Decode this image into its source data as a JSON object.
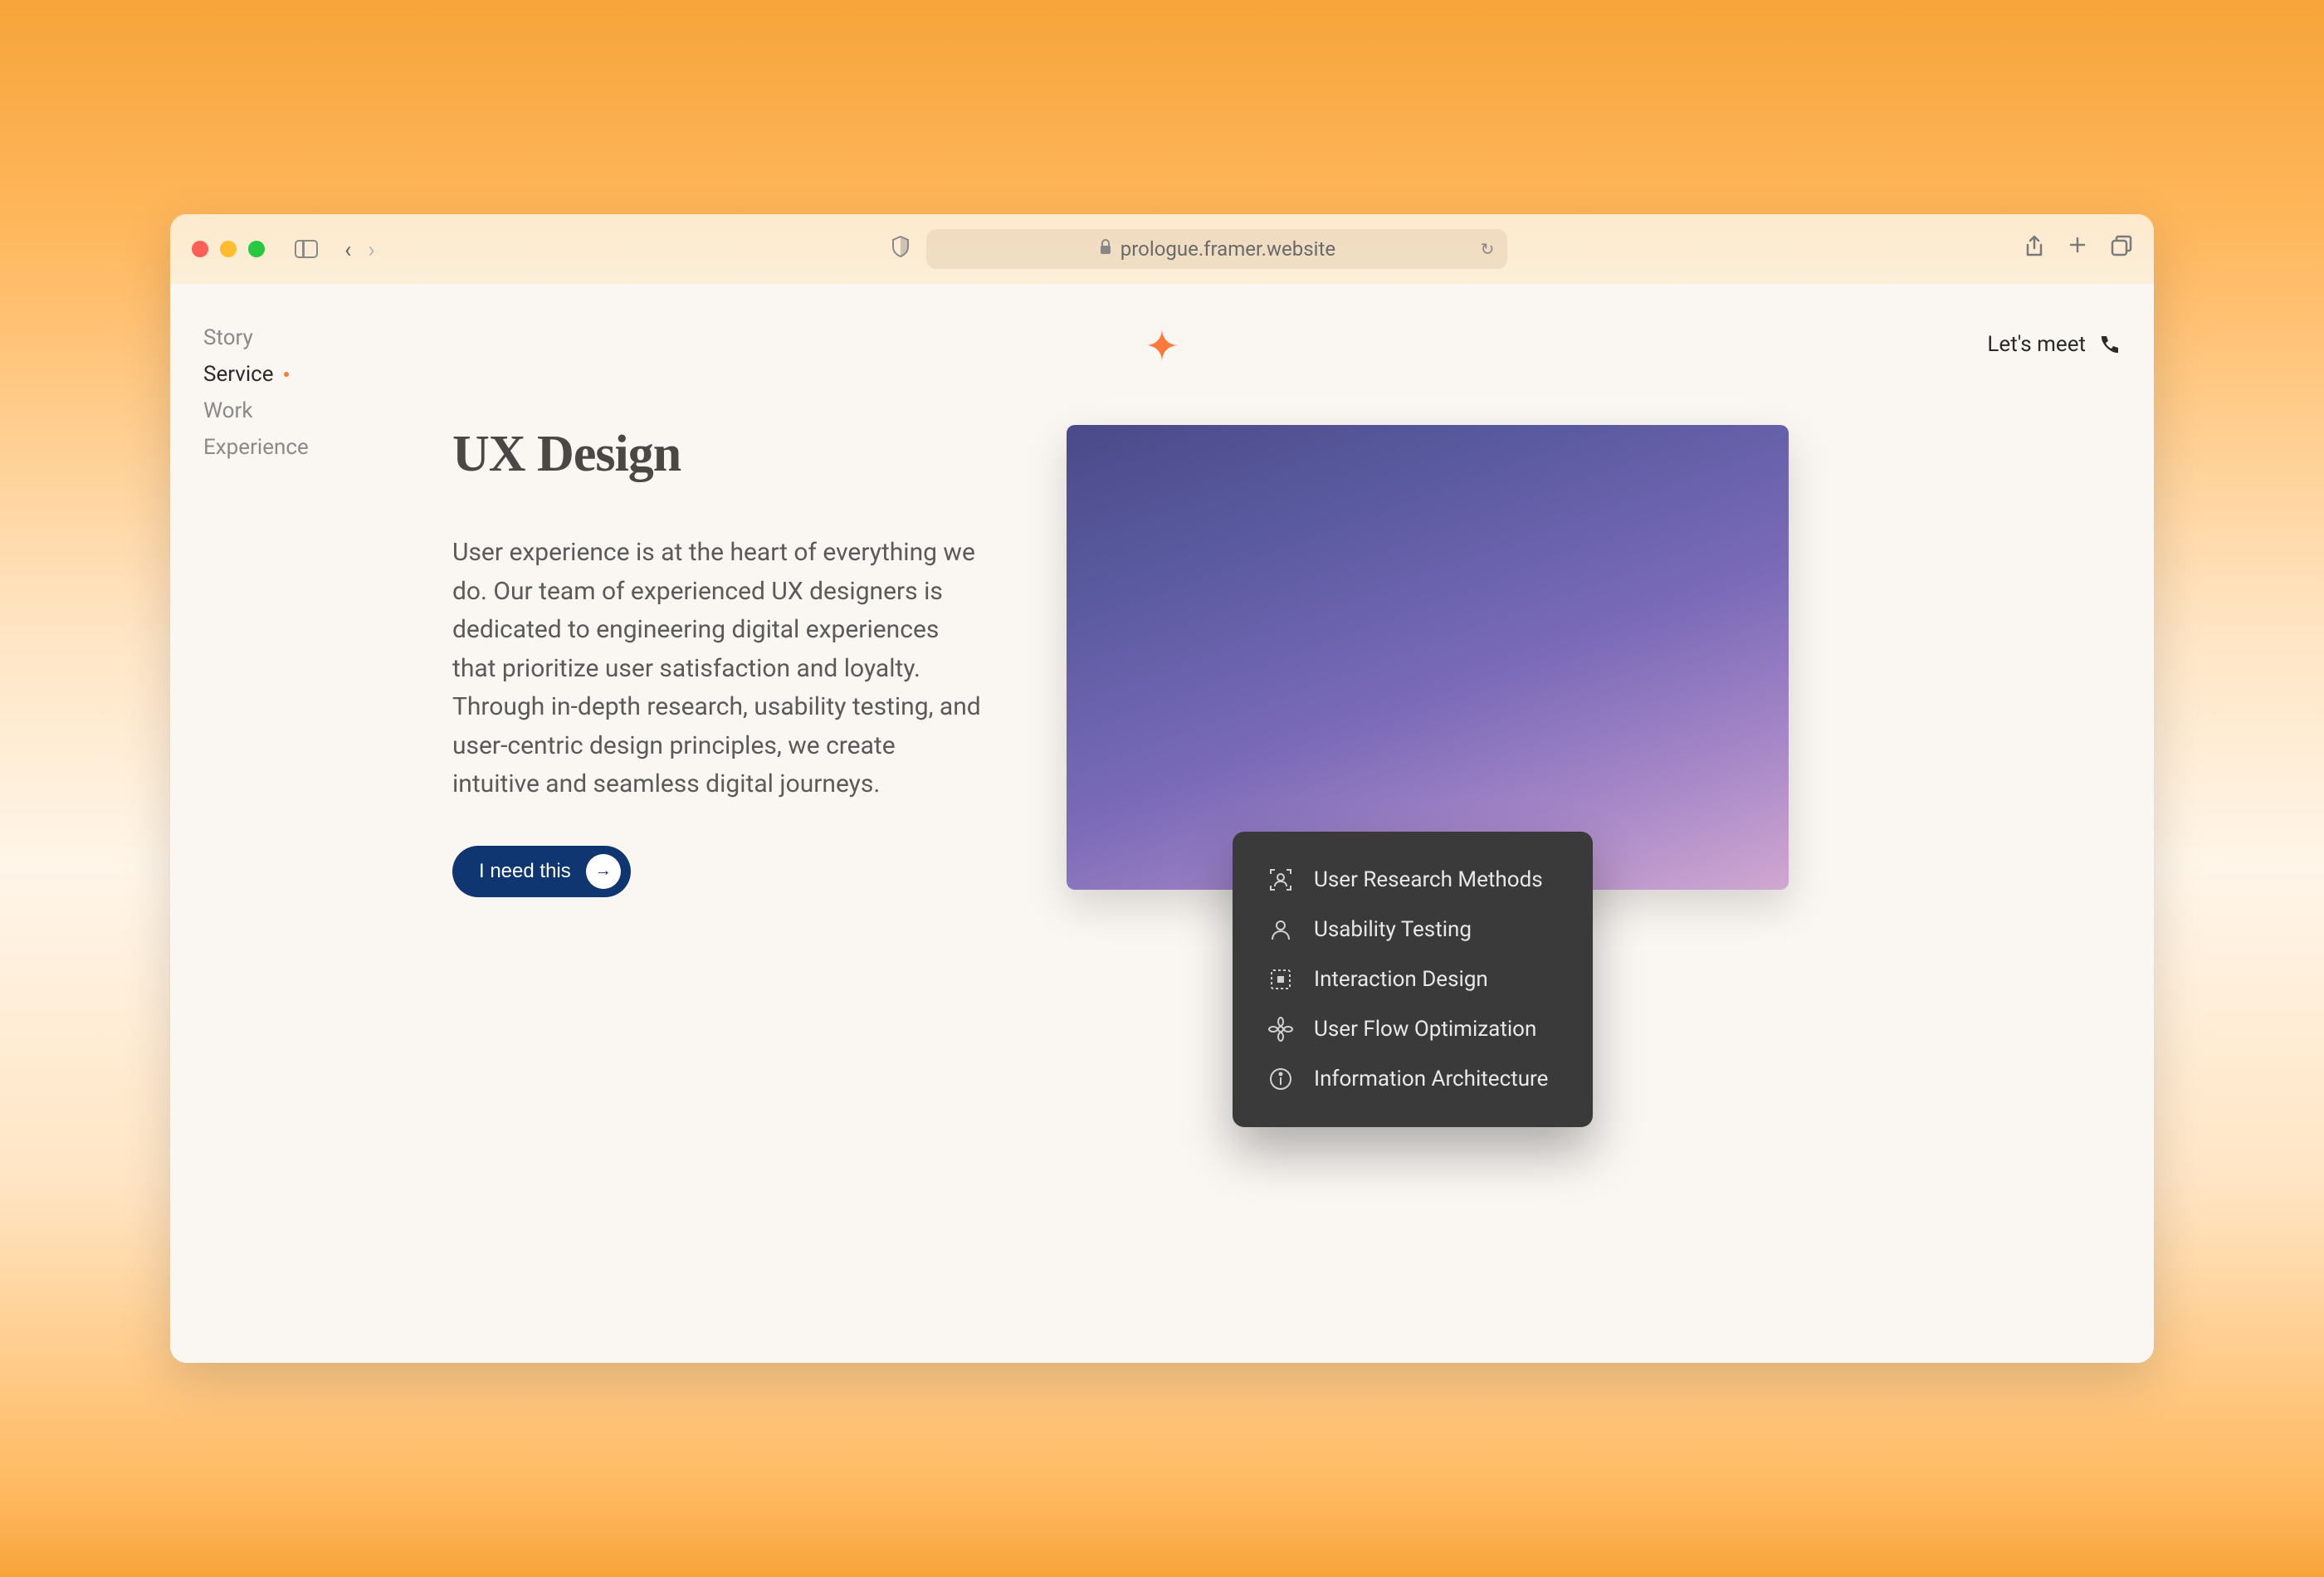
{
  "browser": {
    "url": "prologue.framer.website"
  },
  "nav": {
    "items": [
      {
        "label": "Story",
        "active": false
      },
      {
        "label": "Service",
        "active": true
      },
      {
        "label": "Work",
        "active": false
      },
      {
        "label": "Experience",
        "active": false
      }
    ]
  },
  "header": {
    "cta_label": "Let's meet"
  },
  "content": {
    "heading": "UX Design",
    "body": "User experience is at the heart of everything we do. Our team of experienced UX designers is dedicated to engineering digital experiences that prioritize user satisfaction and loyalty. Through in-depth research, usability testing, and user-centric design principles, we create intuitive and seamless digital journeys.",
    "button_label": "I need this"
  },
  "features": [
    {
      "icon": "user-scan-icon",
      "label": "User Research Methods"
    },
    {
      "icon": "person-icon",
      "label": "Usability Testing"
    },
    {
      "icon": "interaction-icon",
      "label": "Interaction Design"
    },
    {
      "icon": "flower-icon",
      "label": "User Flow Optimization"
    },
    {
      "icon": "info-icon",
      "label": "Information Architecture"
    }
  ]
}
